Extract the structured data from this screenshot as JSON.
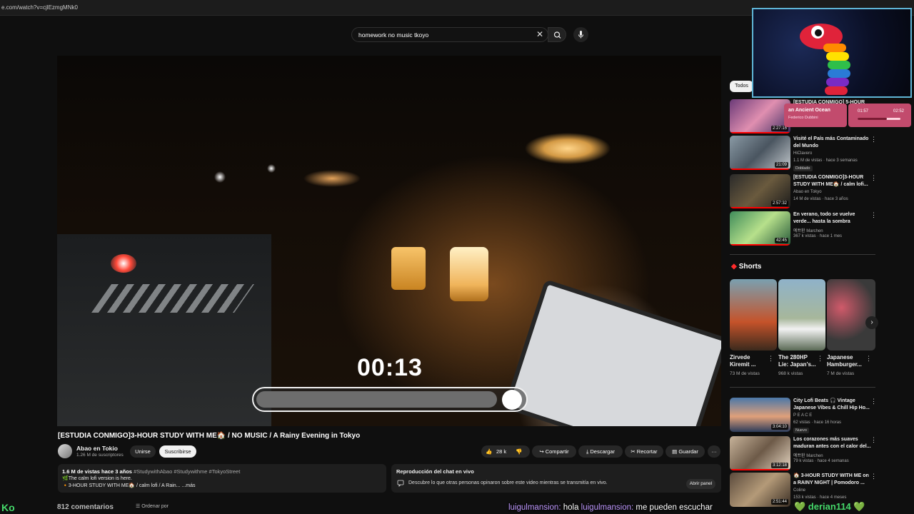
{
  "browser": {
    "url": "e.com/watch?v=cjlEzmgMNk0"
  },
  "search": {
    "query": "homework no music tkoyo",
    "clear_symbol": "✕"
  },
  "player": {
    "timer": "00:13",
    "progress": 0.9
  },
  "video": {
    "title": "[ESTUDIA CONMIGO]3-HOUR STUDY WITH ME🏠 / NO MUSIC / A Rainy Evening in Tokyo",
    "channel_name": "Abao en Tokio",
    "subscribers": "1.26 M de suscriptores",
    "join": "Unirse",
    "subscribe": "Suscribirse",
    "likes": "28 k",
    "share": "Compartir",
    "download": "Descargar",
    "clip": "Recortar",
    "save": "Guardar",
    "more": "···"
  },
  "description": {
    "stats": "1.6 M de vistas  hace 3 años",
    "tags": "#StudywithAbao #Studywithme #TokyoStreet",
    "line2": "🌿The calm lofi version is here.",
    "line3": "🔸3-HOUR STUDY WITH ME🏠 / calm lofi / A Rain...",
    "more": "...más"
  },
  "live_chat": {
    "title": "Reproducción del chat en vivo",
    "desc": "Descubre lo que otras personas opinaron sobre este video mientras se transmitía en vivo.",
    "open": "Abrir panel"
  },
  "comments": {
    "count": "812 comentarios",
    "sort": "Ordenar por"
  },
  "stream_overlay": {
    "ko": "Ko",
    "user1": "luigulmansion:",
    "msg1": "hola",
    "user2": "luigulmansion:",
    "msg2": "me pueden escuchar",
    "derian": "💚 derian114 💚"
  },
  "music_widget": {
    "song": "an Ancient Ocean",
    "artist": "Federico Dubbini",
    "elapsed": "01:57",
    "total": "02:52",
    "progress": 0.68
  },
  "sidebar": {
    "chip": "Todos",
    "recommendations": [
      {
        "title": "[ESTUDIA CONMIGO] 5-HOUR STUDY WITH ME...",
        "channel": "",
        "meta": "",
        "duration": "2:27:15",
        "badge": ""
      },
      {
        "title": "Visité el País más Contaminado del Mundo",
        "channel": "HiClavero",
        "meta": "1.1 M de vistas · hace 3 semanas",
        "duration": "21:09",
        "badge": "Doblado"
      },
      {
        "title": "[ESTUDIA CONMIGO]3-HOUR STUDY WITH ME🏠 / calm lofi...",
        "channel": "Abao en Tokyo",
        "meta": "14 M de vistas · hace 3 años",
        "duration": "2:57:32",
        "badge": ""
      },
      {
        "title": "En verano, todo se vuelve verde... hasta la sombra",
        "channel": "예쁘환 Marchen",
        "meta": "367 k vistas · hace 1 mes",
        "duration": "42:45",
        "badge": ""
      },
      {
        "title": "City Lofi Beats 🎧 Vintage Japanese Vibes & Chill Hip Ho...",
        "channel": "P E A C E",
        "meta": "62 vistas · hace 16 horas",
        "duration": "3:04:10",
        "badge": "Nuevo"
      },
      {
        "title": "Los corazones más suaves maduran antes con el calor del...",
        "channel": "예쁘환 Marchen",
        "meta": "79 k vistas · hace 4 semanas",
        "duration": "3:12:18",
        "badge": ""
      },
      {
        "title": "🏠 3-HOUR STUDY WITH ME on a RAINY NIGHT | Pomodoro ...",
        "channel": "Coline",
        "meta": "153 k vistas · hace 4 meses",
        "duration": "2:51:44",
        "badge": ""
      }
    ],
    "shorts_title": "Shorts",
    "shorts": [
      {
        "title": "Zirvede Kiremit ...",
        "views": "73 M de vistas"
      },
      {
        "title": "The 280HP Lie: Japan's...",
        "views": "968 k vistas"
      },
      {
        "title": "Japanese Hamburger...",
        "views": "7 M de vistas"
      }
    ]
  },
  "colors": {
    "accent_red": "#ff0000",
    "overlay_green": "#45d86a",
    "music_pink": "#c24b6d",
    "webcam_border": "#5fb5d6"
  }
}
